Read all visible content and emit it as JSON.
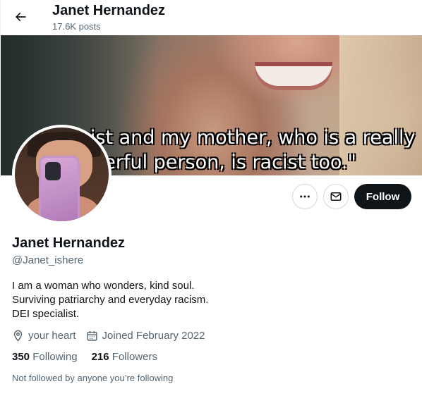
{
  "header": {
    "name": "Janet Hernandez",
    "posts": "17.6K posts",
    "back_icon": "arrow-left-icon"
  },
  "banner": {
    "caption_line_1": "cist and my mother, who is a really",
    "caption_line_2": "nderful person, is racist too.\""
  },
  "actions": {
    "more_icon": "more-horizontal-icon",
    "message_icon": "envelope-icon",
    "follow_label": "Follow"
  },
  "profile": {
    "name": "Janet Hernandez",
    "handle": "@Janet_ishere",
    "bio_lines": [
      "I am a woman who wonders, kind soul.",
      "Surviving patriarchy and everyday racism.",
      "DEI specialist."
    ],
    "location": "your heart",
    "joined": "Joined February 2022",
    "following_count": "350",
    "following_label": "Following",
    "followers_count": "216",
    "followers_label": "Followers",
    "followed_note": "Not followed by anyone you’re following"
  },
  "colors": {
    "text": "#0f1419",
    "secondary": "#536471",
    "follow_bg": "#0f1419",
    "border": "#cfd9de"
  }
}
